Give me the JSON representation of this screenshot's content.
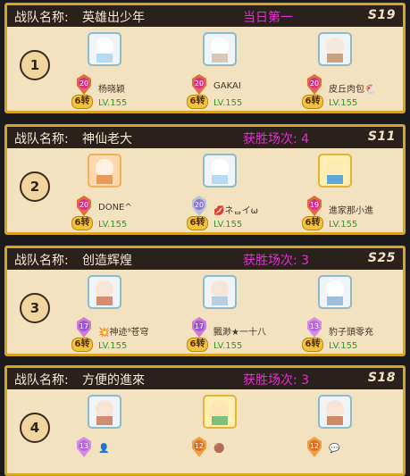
{
  "teams": [
    {
      "label": "战队名称:",
      "name": "英雄出少年",
      "stat": "当日第一",
      "season": "S19",
      "rank": "1",
      "members": [
        {
          "name": "杨晓颖",
          "badge": "20",
          "turns": "6转",
          "level": "LV.155"
        },
        {
          "name": "GAKAI",
          "badge": "20",
          "turns": "6转",
          "level": "LV.155"
        },
        {
          "name": "皮丘肉包🐔",
          "badge": "20",
          "turns": "6转",
          "level": "LV.155"
        }
      ]
    },
    {
      "label": "战队名称:",
      "name": "神仙老大",
      "stat": "获胜场次: 4",
      "season": "S11",
      "rank": "2",
      "members": [
        {
          "name": "DONE^",
          "badge": "20",
          "turns": "6转",
          "level": "LV.155"
        },
        {
          "name": "💋ネᆸイω",
          "badge": "20",
          "turns": "6转",
          "level": "LV.155"
        },
        {
          "name": "進家那小進",
          "badge": "19",
          "turns": "6转",
          "level": "LV.155"
        }
      ]
    },
    {
      "label": "战队名称:",
      "name": "创造辉煌",
      "stat": "获胜场次: 3",
      "season": "S25",
      "rank": "3",
      "members": [
        {
          "name": "💥神迹⁹苍穹",
          "badge": "17",
          "turns": "6转",
          "level": "LV.155"
        },
        {
          "name": "飄渺★一十八",
          "badge": "17",
          "turns": "6转",
          "level": "LV.155"
        },
        {
          "name": "豹子頭零充",
          "badge": "13",
          "turns": "6转",
          "level": "LV.155"
        }
      ]
    },
    {
      "label": "战队名称:",
      "name": "方便的進來",
      "stat": "获胜场次: 3",
      "season": "S18",
      "rank": "4",
      "members": [
        {
          "name": "👤",
          "badge": "13",
          "turns": "",
          "level": ""
        },
        {
          "name": "🟤",
          "badge": "12",
          "turns": "",
          "level": ""
        },
        {
          "name": "💬",
          "badge": "12",
          "turns": "",
          "level": ""
        }
      ]
    }
  ]
}
